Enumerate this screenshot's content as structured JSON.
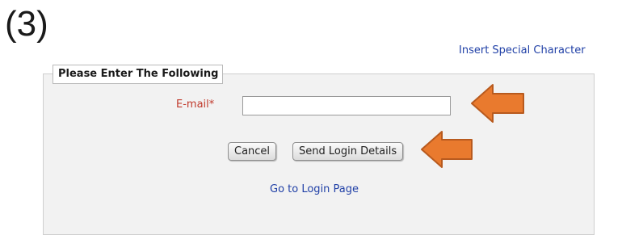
{
  "step_label": "(3)",
  "header": {
    "special_char_link": "Insert Special Character"
  },
  "form": {
    "legend": "Please Enter The Following",
    "email_label": "E-mail*",
    "email_value": "",
    "email_placeholder": "",
    "cancel_label": "Cancel",
    "send_label": "Send Login Details",
    "login_link": "Go to Login Page"
  },
  "annotations": {
    "arrow_color": "#e97a2e",
    "arrow_stroke": "#b85a1e",
    "arrows": [
      "arrow-left-icon",
      "arrow-left-icon"
    ]
  },
  "colors": {
    "link": "#1f3fa6",
    "required_label": "#c0392b",
    "panel_bg": "#f2f2f2"
  }
}
